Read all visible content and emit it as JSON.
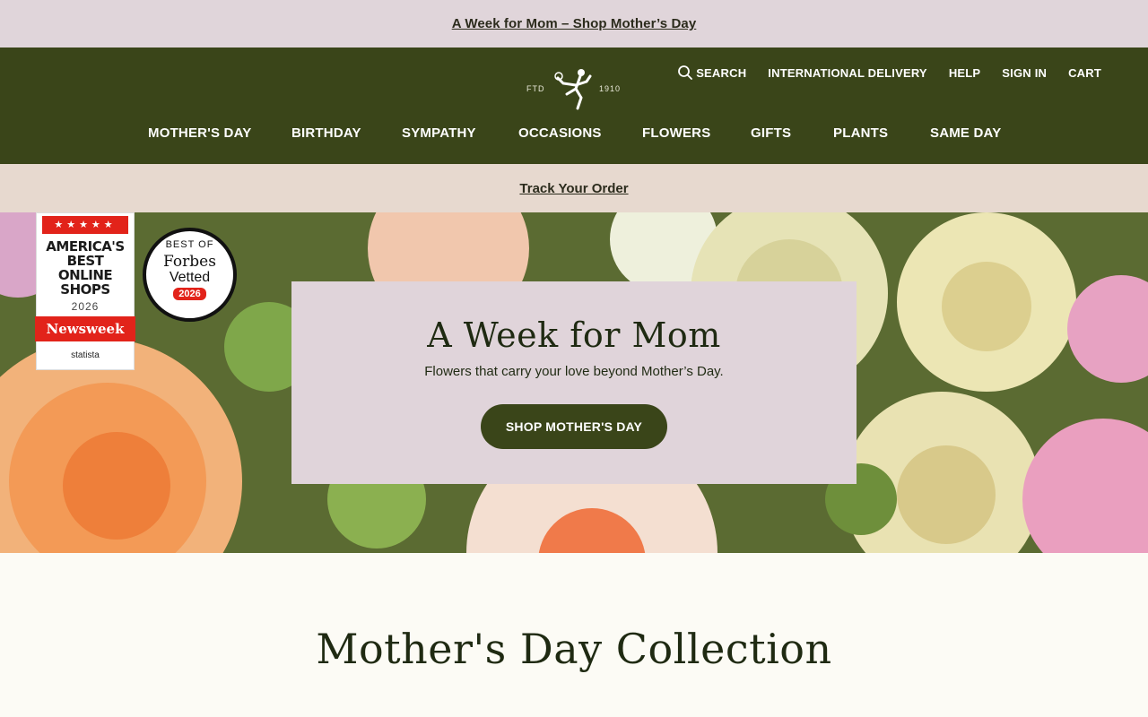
{
  "promo_bar": {
    "link_text": "A Week for Mom – Shop Mother’s Day"
  },
  "header": {
    "logo": {
      "left_text": "FTD",
      "right_text": "1910",
      "icon": "mercury-man-icon"
    },
    "utility_nav": {
      "search": "SEARCH",
      "international": "INTERNATIONAL DELIVERY",
      "help": "HELP",
      "sign_in": "SIGN IN",
      "cart": "CART"
    },
    "main_nav": [
      {
        "label": "MOTHER'S DAY"
      },
      {
        "label": "BIRTHDAY"
      },
      {
        "label": "SYMPATHY"
      },
      {
        "label": "OCCASIONS"
      },
      {
        "label": "FLOWERS"
      },
      {
        "label": "GIFTS"
      },
      {
        "label": "PLANTS"
      },
      {
        "label": "SAME DAY"
      }
    ]
  },
  "track_bar": {
    "link_text": "Track Your Order"
  },
  "hero": {
    "title": "A Week for Mom",
    "subtitle": "Flowers that carry your love beyond Mother’s Day.",
    "cta": "SHOP MOTHER'S DAY",
    "badge_newsweek": {
      "stars": "★★★★★",
      "line1": "AMERICA'S",
      "line2": "BEST",
      "line3": "ONLINE",
      "line4": "SHOPS",
      "year": "2026",
      "brand": "Newsweek",
      "powered": "statista"
    },
    "badge_forbes": {
      "top": "BEST OF",
      "brand": "Forbes",
      "label": "Vetted",
      "year": "2026"
    }
  },
  "collection": {
    "title": "Mother's Day Collection"
  },
  "colors": {
    "header_green": "#3a4519",
    "promo_pink": "#e0d5da",
    "track_beige": "#e7d9cf",
    "page_bg": "#fcfbf5"
  }
}
